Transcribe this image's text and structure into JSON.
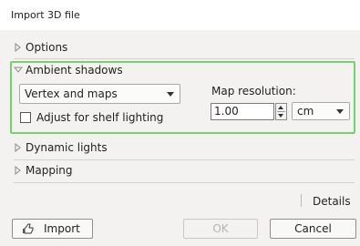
{
  "window": {
    "title": "Import 3D file"
  },
  "sections": {
    "options": {
      "label": "Options"
    },
    "ambient": {
      "label": "Ambient shadows",
      "mode_value": "Vertex and maps",
      "checkbox_label": "Adjust for shelf lighting",
      "checkbox_checked": false,
      "resolution_label": "Map resolution:",
      "resolution_value": "1.00",
      "unit_value": "cm"
    },
    "dynamic": {
      "label": "Dynamic lights"
    },
    "mapping": {
      "label": "Mapping"
    }
  },
  "details_label": "Details",
  "buttons": {
    "import": "Import",
    "ok": "OK",
    "cancel": "Cancel"
  },
  "colors": {
    "highlight_border": "#74d36b",
    "disabled_text": "#b3b3b3"
  },
  "icons": {
    "collapsed": "triangle-right-icon",
    "expanded": "triangle-down-icon",
    "import": "import-hand-icon"
  }
}
